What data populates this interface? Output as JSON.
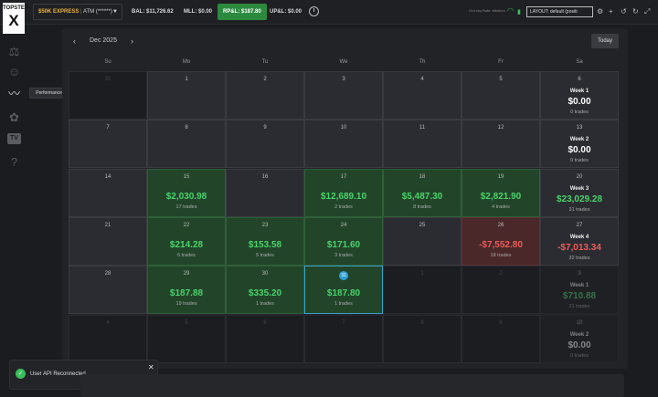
{
  "brand": {
    "top": "TOPSTEP",
    "mark": "X"
  },
  "topbar": {
    "account_name": "$50K EXPRESS",
    "account_atm": "ATM (******)",
    "balance": "BAL: $11,726.62",
    "mll": "MLL: $0.00",
    "rpl": "RP&L: $187.80",
    "upl": "UP&L: $0.00",
    "latency": "Ord-req Rate: Medium",
    "layout": "LAYOUT: default (positi"
  },
  "tooltip": "Performance Stats",
  "calendar": {
    "month": "Dec 2025",
    "today_label": "Today",
    "weekdays": [
      "Su",
      "Mo",
      "Tu",
      "We",
      "Th",
      "Fr",
      "Sa"
    ],
    "rows": [
      [
        {
          "day": "30",
          "type": "blank"
        },
        {
          "day": "1",
          "type": "normal"
        },
        {
          "day": "2",
          "type": "normal"
        },
        {
          "day": "3",
          "type": "normal"
        },
        {
          "day": "4",
          "type": "normal"
        },
        {
          "day": "5",
          "type": "normal"
        },
        {
          "day": "6",
          "type": "week",
          "week": "Week 1",
          "pnl": "$0.00",
          "trades": "0 trades",
          "tone": "w"
        }
      ],
      [
        {
          "day": "7",
          "type": "normal"
        },
        {
          "day": "8",
          "type": "normal"
        },
        {
          "day": "9",
          "type": "normal"
        },
        {
          "day": "10",
          "type": "normal"
        },
        {
          "day": "11",
          "type": "normal"
        },
        {
          "day": "12",
          "type": "normal"
        },
        {
          "day": "13",
          "type": "week",
          "week": "Week 2",
          "pnl": "$0.00",
          "trades": "0 trades",
          "tone": "w"
        }
      ],
      [
        {
          "day": "14",
          "type": "normal"
        },
        {
          "day": "15",
          "type": "green",
          "pnl": "$2,030.98",
          "trades": "17 trades"
        },
        {
          "day": "16",
          "type": "normal"
        },
        {
          "day": "17",
          "type": "green",
          "pnl": "$12,689.10",
          "trades": "2 trades"
        },
        {
          "day": "18",
          "type": "green",
          "pnl": "$5,487.30",
          "trades": "8 trades"
        },
        {
          "day": "19",
          "type": "green",
          "pnl": "$2,821.90",
          "trades": "4 trades"
        },
        {
          "day": "20",
          "type": "week",
          "week": "Week 3",
          "pnl": "$23,029.28",
          "trades": "31 trades",
          "tone": "g"
        }
      ],
      [
        {
          "day": "21",
          "type": "normal"
        },
        {
          "day": "22",
          "type": "green",
          "pnl": "$214.28",
          "trades": "6 trades"
        },
        {
          "day": "23",
          "type": "green",
          "pnl": "$153.58",
          "trades": "5 trades"
        },
        {
          "day": "24",
          "type": "green",
          "pnl": "$171.60",
          "trades": "3 trades"
        },
        {
          "day": "25",
          "type": "normal"
        },
        {
          "day": "26",
          "type": "red",
          "pnl": "-$7,552.80",
          "trades": "18 trades"
        },
        {
          "day": "27",
          "type": "week",
          "week": "Week 4",
          "pnl": "-$7,013.34",
          "trades": "32 trades",
          "tone": "r"
        }
      ],
      [
        {
          "day": "28",
          "type": "normal"
        },
        {
          "day": "29",
          "type": "green",
          "pnl": "$187.88",
          "trades": "19 trades"
        },
        {
          "day": "30",
          "type": "green",
          "pnl": "$335.20",
          "trades": "1 trades"
        },
        {
          "day": "31",
          "type": "green",
          "pnl": "$187.80",
          "trades": "1 trades",
          "today": true
        },
        {
          "day": "1",
          "type": "blank"
        },
        {
          "day": "2",
          "type": "blank"
        },
        {
          "day": "3",
          "type": "week",
          "week": "Week 1",
          "pnl": "$710.88",
          "trades": "21 trades",
          "tone": "g",
          "dim": true
        }
      ],
      [
        {
          "day": "4",
          "type": "blank"
        },
        {
          "day": "5",
          "type": "blank"
        },
        {
          "day": "6",
          "type": "blank"
        },
        {
          "day": "7",
          "type": "blank"
        },
        {
          "day": "8",
          "type": "blank"
        },
        {
          "day": "9",
          "type": "blank"
        },
        {
          "day": "10",
          "type": "week",
          "week": "Week 2",
          "pnl": "$0.00",
          "trades": "0 trades",
          "tone": "w",
          "dim": true
        }
      ]
    ]
  },
  "toast": {
    "message": "User API Reconnected"
  },
  "colors": {
    "green": "#49d36a",
    "red": "#ec5b5b",
    "accent": "#2f9fd6",
    "profit_cell": "#22452a",
    "loss_cell": "#4a2729"
  }
}
